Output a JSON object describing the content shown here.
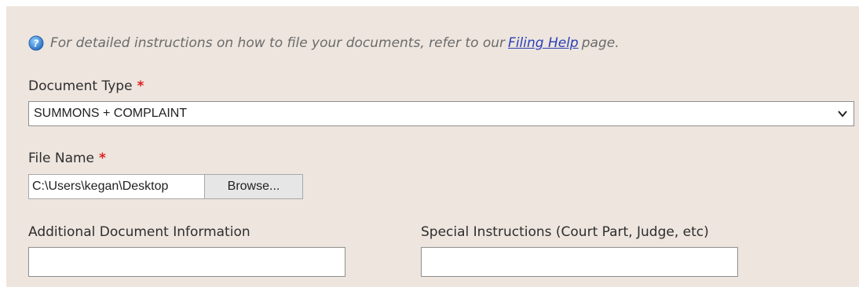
{
  "help": {
    "text_before": "For detailed instructions on how to file your documents, refer to our",
    "link_label": "Filing Help",
    "text_after": "page."
  },
  "document_type": {
    "label": "Document Type",
    "required_mark": "*",
    "selected_value": "SUMMONS + COMPLAINT"
  },
  "file_name": {
    "label": "File Name",
    "required_mark": "*",
    "value": "C:\\Users\\kegan\\Desktop",
    "browse_label": "Browse..."
  },
  "additional_info": {
    "label": "Additional Document Information",
    "value": ""
  },
  "special_instructions": {
    "label": "Special Instructions (Court Part, Judge, etc)",
    "value": ""
  },
  "colors": {
    "panel_bg": "#ede5de",
    "required": "#e02020",
    "link": "#2b3fb6",
    "help_icon": "#2f7fd1"
  },
  "icons": {
    "help": "help-icon",
    "dropdown": "chevron-down-icon"
  }
}
